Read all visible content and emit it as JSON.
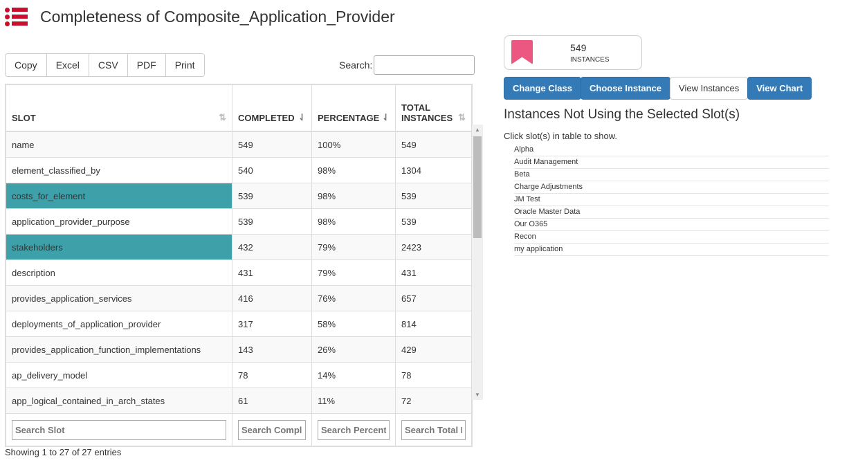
{
  "header": {
    "title": "Completeness of Composite_Application_Provider",
    "icon": "list-icon"
  },
  "toolbar": {
    "buttons": [
      "Copy",
      "Excel",
      "CSV",
      "PDF",
      "Print"
    ],
    "search_label": "Search:",
    "search_value": ""
  },
  "table": {
    "columns": [
      "SLOT",
      "COMPLETED",
      "PERCENTAGE",
      "TOTAL\nINSTANCES"
    ],
    "rows": [
      {
        "slot": "name",
        "completed": "549",
        "percentage": "100%",
        "total": "549",
        "selected": false
      },
      {
        "slot": "element_classified_by",
        "completed": "540",
        "percentage": "98%",
        "total": "1304",
        "selected": false
      },
      {
        "slot": "costs_for_element",
        "completed": "539",
        "percentage": "98%",
        "total": "539",
        "selected": true
      },
      {
        "slot": "application_provider_purpose",
        "completed": "539",
        "percentage": "98%",
        "total": "539",
        "selected": false
      },
      {
        "slot": "stakeholders",
        "completed": "432",
        "percentage": "79%",
        "total": "2423",
        "selected": true
      },
      {
        "slot": "description",
        "completed": "431",
        "percentage": "79%",
        "total": "431",
        "selected": false
      },
      {
        "slot": "provides_application_services",
        "completed": "416",
        "percentage": "76%",
        "total": "657",
        "selected": false
      },
      {
        "slot": "deployments_of_application_provider",
        "completed": "317",
        "percentage": "58%",
        "total": "814",
        "selected": false
      },
      {
        "slot": "provides_application_function_implementations",
        "completed": "143",
        "percentage": "26%",
        "total": "429",
        "selected": false
      },
      {
        "slot": "ap_delivery_model",
        "completed": "78",
        "percentage": "14%",
        "total": "78",
        "selected": false
      },
      {
        "slot": "app_logical_contained_in_arch_states",
        "completed": "61",
        "percentage": "11%",
        "total": "72",
        "selected": false
      }
    ],
    "footer_placeholders": [
      "Search Slot",
      "Search Completed",
      "Search Percentage",
      "Search Total Instances"
    ],
    "info": "Showing 1 to 27 of 27 entries"
  },
  "stat": {
    "value": "549",
    "label": "INSTANCES",
    "color": "#eb5780"
  },
  "actions": [
    "Change Class",
    "Choose Instance",
    "View Instances",
    "View Chart"
  ],
  "instances_panel": {
    "title": "Instances Not Using the Selected Slot(s)",
    "hint": "Click slot(s) in table to show.",
    "items": [
      "Alpha",
      "Audit Management",
      "Beta",
      "Charge Adjustments",
      "JM Test",
      "Oracle Master Data",
      "Our O365",
      "Recon",
      "my application"
    ]
  },
  "colors": {
    "accent": "#c8102e",
    "selected": "#3ea0a8",
    "button": "#337ab7"
  }
}
